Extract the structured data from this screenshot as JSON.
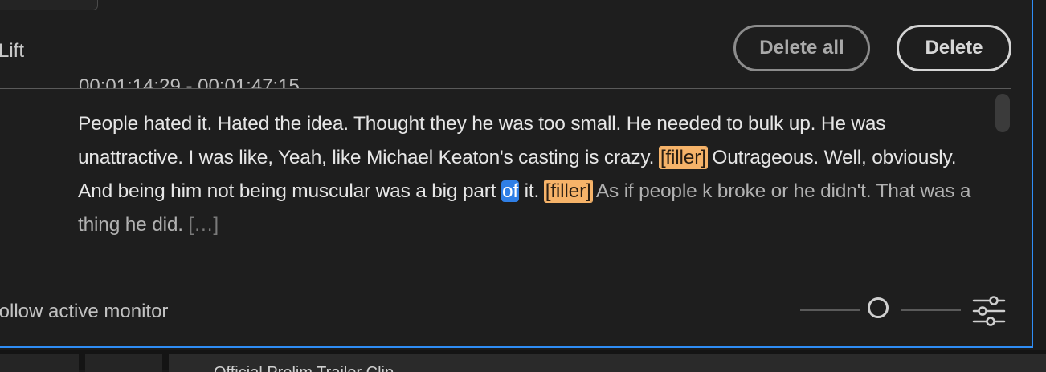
{
  "toolbar": {
    "mode_label": "Lift",
    "delete_all_label": "Delete all",
    "delete_label": "Delete"
  },
  "transcript": {
    "timestamp": "00;01;14;29 - 00;01;47;15",
    "seg1": "People hated it. Hated the idea. Thought they he was too small. He needed to bulk up. He was unattractive. I was like, Yeah, like Michael Keaton's casting is crazy. ",
    "filler_1": "[filler]",
    "seg2": " Outrageous. Well, obviously. And being him not being muscular was a big part ",
    "selected_word": "of",
    "seg3": " it. ",
    "filler_2": "[filler]",
    "seg4": " As if people k broke or he didn't. That was a thing he did. ",
    "more": "[…]"
  },
  "footer": {
    "follow_label": "Follow active monitor",
    "zoom_slider_value": 0.5
  },
  "bottom_tabs": {
    "tab3_label": "Official Prelim Trailer Clip"
  },
  "colors": {
    "accent_border": "#2f8df5",
    "filler_highlight": "#f6b369",
    "selection": "#2f7fe6"
  },
  "icons": {
    "settings": "sliders-icon"
  }
}
